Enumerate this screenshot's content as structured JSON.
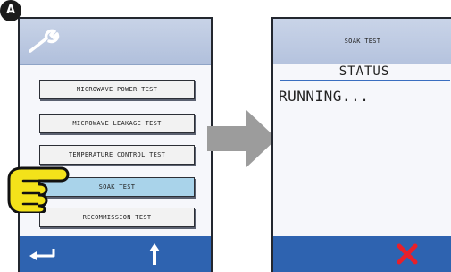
{
  "badge": {
    "label": "A"
  },
  "left_screen": {
    "menu": [
      {
        "label": "MICROWAVE POWER TEST",
        "active": false
      },
      {
        "label": "MICROWAVE LEAKAGE TEST",
        "active": false
      },
      {
        "label": "TEMPERATURE CONTROL TEST",
        "active": false
      },
      {
        "label": "SOAK TEST",
        "active": true
      },
      {
        "label": "RECOMMISSION TEST",
        "active": false
      }
    ],
    "footer_icons": [
      "back-arrow-icon",
      "up-arrow-icon"
    ],
    "header_icon": "wrench-icon"
  },
  "right_screen": {
    "title": "SOAK TEST",
    "status_label": "STATUS",
    "status_text": "RUNNING...",
    "footer_icons": [
      "close-icon"
    ]
  },
  "colors": {
    "footer_blue": "#2e63b0",
    "header_blue": "#b8c6df",
    "active_button": "#a9d3ea",
    "close_red": "#e8202a",
    "hand_yellow": "#f3e21a"
  }
}
